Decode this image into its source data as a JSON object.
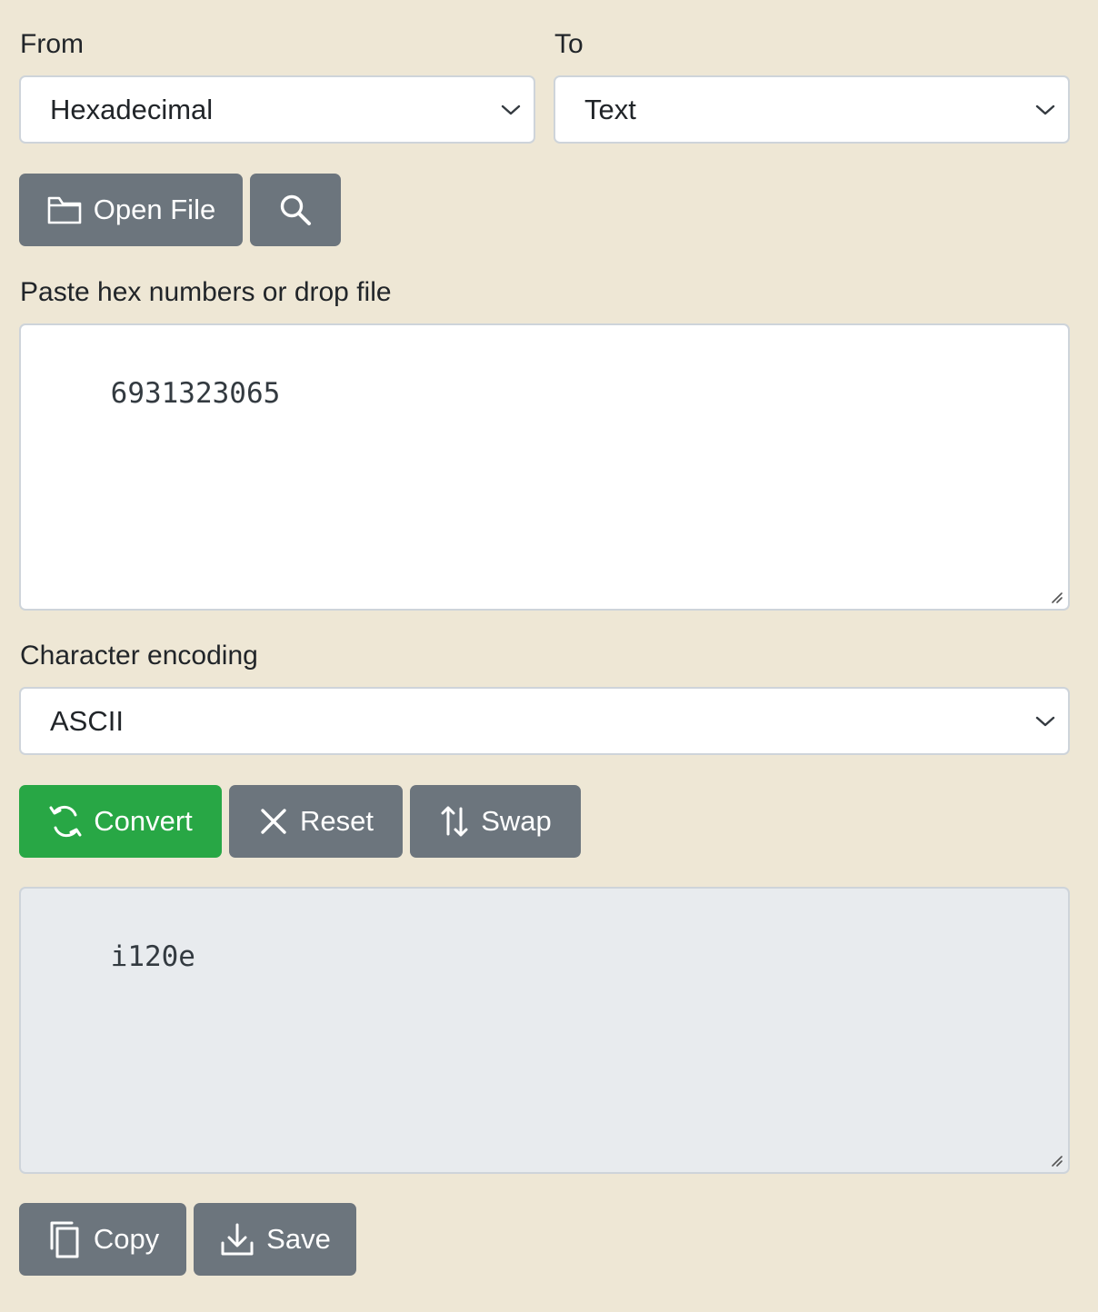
{
  "from": {
    "label": "From",
    "selected": "Hexadecimal"
  },
  "to": {
    "label": "To",
    "selected": "Text"
  },
  "file_toolbar": {
    "open_file_label": "Open File",
    "open_file_icon": "folder-icon",
    "search_icon": "search-icon"
  },
  "input": {
    "label": "Paste hex numbers or drop file",
    "value": "6931323065"
  },
  "encoding": {
    "label": "Character encoding",
    "selected": "ASCII"
  },
  "actions": {
    "convert_label": "Convert",
    "reset_label": "Reset",
    "swap_label": "Swap"
  },
  "output": {
    "value": "i120e"
  },
  "output_toolbar": {
    "copy_label": "Copy",
    "save_label": "Save"
  },
  "colors": {
    "background": "#eee7d5",
    "secondary_button": "#6c757d",
    "success_button": "#28a745",
    "readonly_field": "#e8ebee"
  }
}
